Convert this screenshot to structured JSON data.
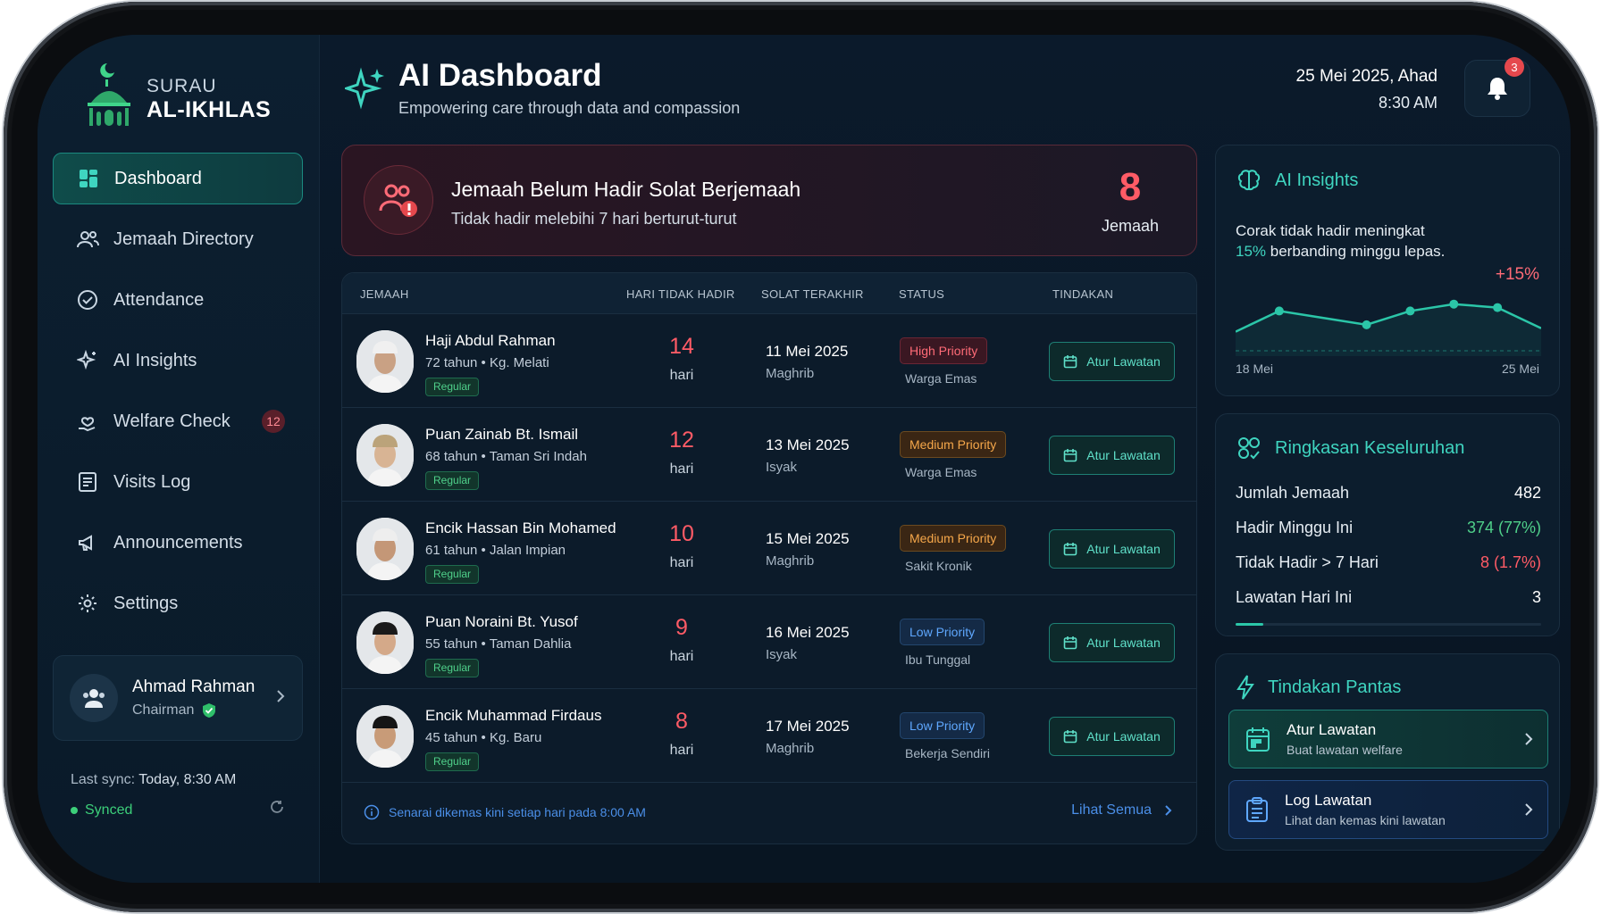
{
  "brand": {
    "top": "SURAU",
    "main": "AL-IKHLAS"
  },
  "nav": [
    {
      "label": "Dashboard",
      "icon": "dashboard-icon"
    },
    {
      "label": "Jemaah Directory",
      "icon": "users-icon"
    },
    {
      "label": "Attendance",
      "icon": "check-circle-icon"
    },
    {
      "label": "AI Insights",
      "icon": "sparkle-icon"
    },
    {
      "label": "Welfare Check",
      "icon": "heart-hand-icon",
      "badge": "12"
    },
    {
      "label": "Visits Log",
      "icon": "document-icon"
    },
    {
      "label": "Announcements",
      "icon": "megaphone-icon"
    },
    {
      "label": "Settings",
      "icon": "gear-icon"
    }
  ],
  "user": {
    "name": "Ahmad Rahman",
    "role": "Chairman"
  },
  "sync": {
    "last_label": "Last sync:",
    "last_value": "Today, 8:30 AM",
    "status": "Synced"
  },
  "header": {
    "title": "AI Dashboard",
    "subtitle": "Empowering care through data and compassion",
    "date": "25 Mei 2025, Ahad",
    "time": "8:30 AM",
    "notifications": "3"
  },
  "alert": {
    "title": "Jemaah Belum Hadir Solat Berjemaah",
    "subtitle": "Tidak hadir melebihi 7 hari berturut-turut",
    "count": "8",
    "unit": "Jemaah"
  },
  "table": {
    "headers": [
      "JEMAAH",
      "HARI TIDAK HADIR",
      "SOLAT TERAKHIR",
      "STATUS",
      "TINDAKAN"
    ],
    "action_label": "Atur Lawatan",
    "days_unit": "hari",
    "rows": [
      {
        "name": "Haji Abdul Rahman",
        "meta": "72 tahun • Kg. Melati",
        "tag": "Regular",
        "days": "14",
        "last_date": "11 Mei 2025",
        "last_prayer": "Maghrib",
        "priority": "High Priority",
        "status_sub": "Warga Emas"
      },
      {
        "name": "Puan Zainab Bt. Ismail",
        "meta": "68 tahun • Taman Sri Indah",
        "tag": "Regular",
        "days": "12",
        "last_date": "13 Mei 2025",
        "last_prayer": "Isyak",
        "priority": "Medium Priority",
        "status_sub": "Warga Emas"
      },
      {
        "name": "Encik Hassan Bin Mohamed",
        "meta": "61 tahun • Jalan Impian",
        "tag": "Regular",
        "days": "10",
        "last_date": "15 Mei 2025",
        "last_prayer": "Maghrib",
        "priority": "Medium Priority",
        "status_sub": "Sakit Kronik"
      },
      {
        "name": "Puan Noraini Bt. Yusof",
        "meta": "55 tahun • Taman Dahlia",
        "tag": "Regular",
        "days": "9",
        "last_date": "16 Mei 2025",
        "last_prayer": "Isyak",
        "priority": "Low Priority",
        "status_sub": "Ibu Tunggal"
      },
      {
        "name": "Encik Muhammad Firdaus",
        "meta": "45 tahun • Kg. Baru",
        "tag": "Regular",
        "days": "8",
        "last_date": "17 Mei 2025",
        "last_prayer": "Maghrib",
        "priority": "Low Priority",
        "status_sub": "Bekerja Sendiri"
      }
    ],
    "footer_note": "Senarai dikemas kini setiap hari pada 8:00 AM",
    "view_all": "Lihat Semua"
  },
  "insights": {
    "title": "AI Insights",
    "text_1": "Corak tidak hadir meningkat",
    "text_highlight": "15%",
    "text_2": " berbanding minggu lepas.",
    "change": "+15%",
    "start_label": "18 Mei",
    "end_label": "25 Mei"
  },
  "chart_data": {
    "type": "line",
    "x": [
      "18 Mei",
      "19 Mei",
      "20 Mei",
      "21 Mei",
      "22 Mei",
      "23 Mei",
      "24 Mei",
      "25 Mei"
    ],
    "values": [
      2,
      5,
      4,
      3,
      5,
      6,
      5.5,
      2.5
    ],
    "marker_indices": [
      1,
      3,
      4,
      5,
      6
    ],
    "color": "#2bc6a8"
  },
  "summary": {
    "title": "Ringkasan Keseluruhan",
    "rows": [
      {
        "label": "Jumlah Jemaah",
        "value": "482",
        "color": "#ffffff"
      },
      {
        "label": "Hadir Minggu Ini",
        "value": "374 (77%)",
        "color": "#4fd08a"
      },
      {
        "label": "Tidak Hadir > 7 Hari",
        "value": "8 (1.7%)",
        "color": "#ff5b66"
      },
      {
        "label": "Lawatan Hari Ini",
        "value": "3",
        "color": "#ffffff"
      }
    ]
  },
  "quick_actions": {
    "title": "Tindakan Pantas",
    "items": [
      {
        "title": "Atur Lawatan",
        "sub": "Buat lawatan welfare"
      },
      {
        "title": "Log Lawatan",
        "sub": "Lihat dan kemas kini lawatan"
      }
    ]
  },
  "colors": {
    "accent": "#2bc6a8",
    "danger": "#ff5b66",
    "link": "#4b8fe8",
    "background": "#0b1a2b"
  }
}
